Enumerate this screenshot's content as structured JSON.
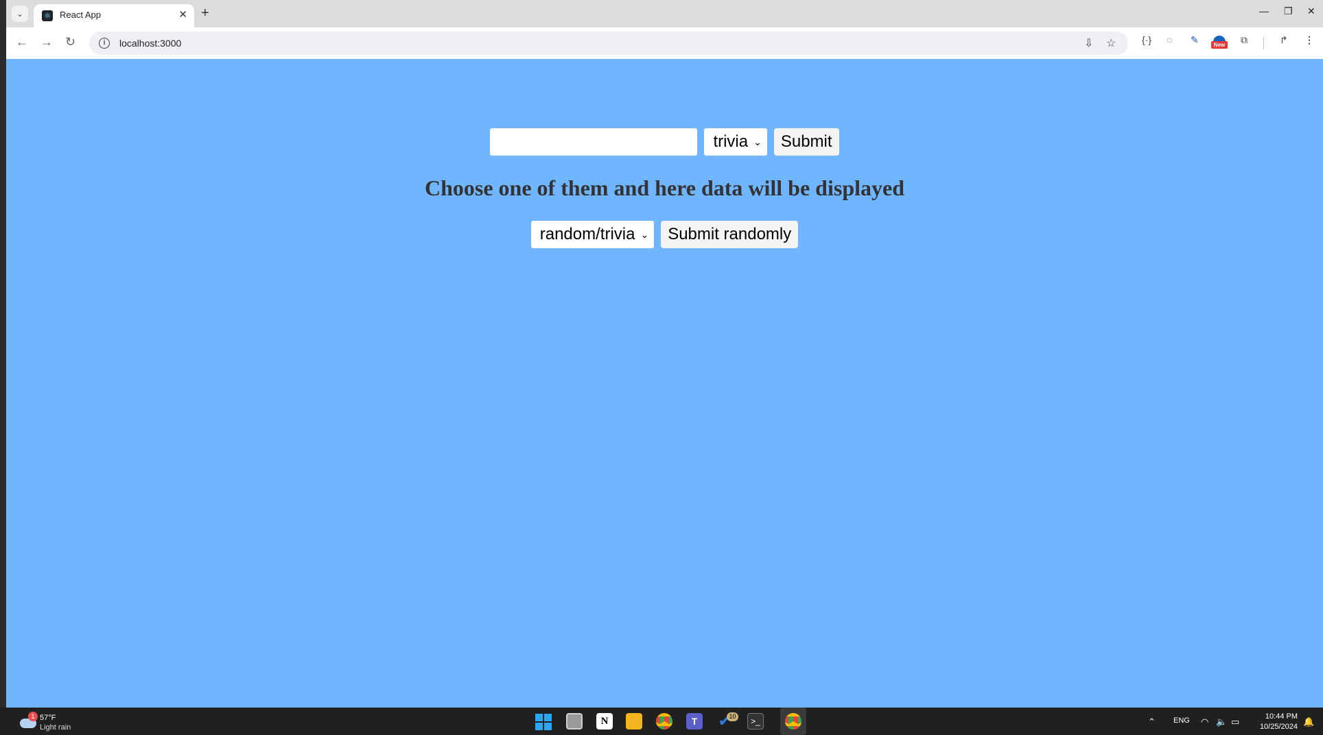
{
  "browser": {
    "tab_title": "React App",
    "url": "localhost:3000",
    "new_tab_symbol": "+",
    "close_tab_symbol": "✕",
    "ext_new_label": "New"
  },
  "form": {
    "text_input_value": "",
    "category_select": "trivia",
    "submit_label": "Submit"
  },
  "heading": "Choose one of them and here data will be displayed",
  "random_form": {
    "select_value": "random/trivia",
    "submit_label": "Submit randomly"
  },
  "taskbar": {
    "weather_temp": "57°F",
    "weather_desc": "Light rain",
    "weather_badge": "1",
    "todo_badge": "10",
    "lang": "ENG",
    "time": "10:44 PM",
    "date": "10/25/2024"
  },
  "colors": {
    "page_background": "#70b5ff",
    "heading_text": "#333333"
  }
}
